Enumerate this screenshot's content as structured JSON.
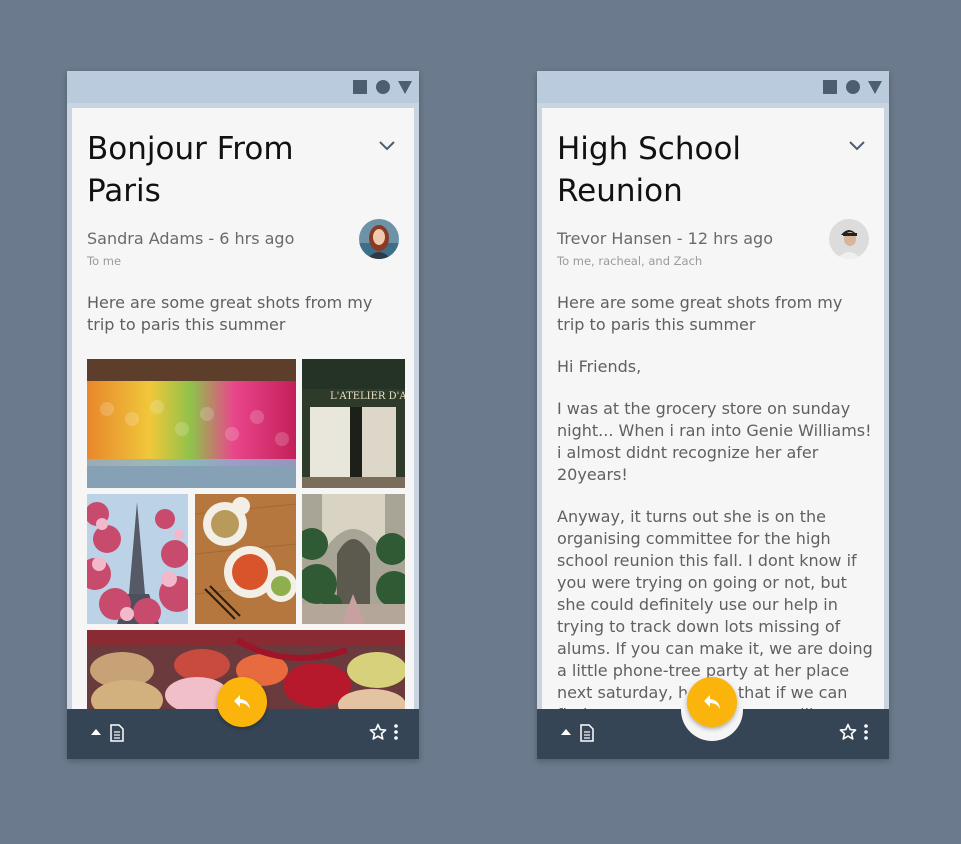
{
  "screens": [
    {
      "title": "Bonjour From Paris",
      "sender": "Sandra Adams - 6 hrs ago",
      "recipients": "To me",
      "paragraphs": [
        "Here are some great shots from my trip to paris this summer"
      ],
      "photos": [
        "macarons-display-photo",
        "cafe-storefront-photo",
        "eiffel-tower-blossoms-photo",
        "food-plates-photo",
        "arcade-garden-photo",
        "macarons-closeup-photo"
      ]
    },
    {
      "title": "High School Reunion",
      "sender": "Trevor Hansen - 12 hrs ago",
      "recipients": "To me, racheal, and Zach",
      "paragraphs": [
        "Here are some great shots from my trip to paris this summer",
        "Hi Friends,",
        "I was at the grocery store on sunday night... When i ran into Genie Williams! i almost didnt recognize her afer 20years!",
        "Anyway, it turns out she is on the organising committee for the high school reunion this fall. I dont know if you were trying on going or not, but she could definitely use our help in trying to track down lots missing of alums. If you can make it, we are doing a little phone-tree party at her place next saturday, hoping that if we can find any person, a few more will emerge. What do you say? Should we"
      ]
    }
  ],
  "photo_text": "L'ATELIER D'ANTAN",
  "toolbar_icons": [
    "caret-up-icon",
    "document-icon",
    "star-icon",
    "more-vert-icon"
  ],
  "fab_icon": "reply-icon",
  "colors": {
    "background": "#6b7b8d",
    "statusbar": "#b9cbdc",
    "toolbar": "#364555",
    "fab": "#fbb40b"
  }
}
